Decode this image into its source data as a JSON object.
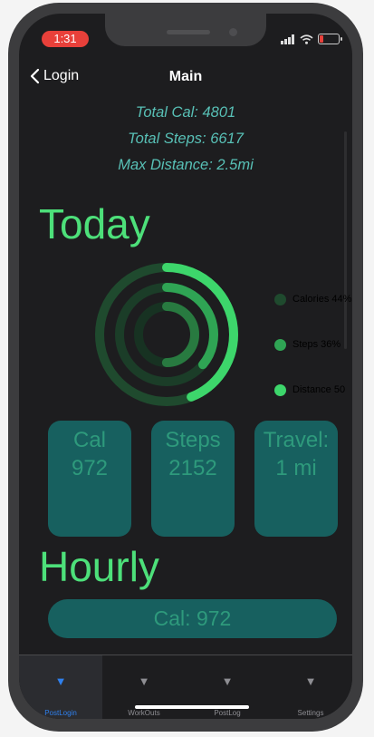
{
  "status_bar": {
    "time": "1:31"
  },
  "nav": {
    "back_label": "Login",
    "title": "Main"
  },
  "totals": {
    "total_cal": "Total Cal: 4801",
    "total_steps": "Total Steps: 6617",
    "max_distance": "Max Distance: 2.5mi"
  },
  "today": {
    "title": "Today",
    "rings": [
      {
        "name": "Calories",
        "percent": 44,
        "color": "#3dd66b",
        "track": "#1f4a2e"
      },
      {
        "name": "Steps",
        "percent": 36,
        "color": "#2fa454",
        "track": "#1b3d28"
      },
      {
        "name": "Distance",
        "percent": 50,
        "color": "#287a40",
        "track": "#173222"
      }
    ],
    "legend": [
      {
        "label": "Calories 44%",
        "color": "#1f4a2e"
      },
      {
        "label": "Steps 36%",
        "color": "#2fa454"
      },
      {
        "label": "Distance 50",
        "color": "#3dd66b"
      }
    ],
    "cards": [
      {
        "line1": "Cal",
        "line2": "972"
      },
      {
        "line1": "Steps",
        "line2": "2152"
      },
      {
        "line1": "Travel:",
        "line2": "1 mi"
      }
    ]
  },
  "hourly": {
    "title": "Hourly",
    "button_label": "Cal: 972"
  },
  "tabs": [
    {
      "label": "PostLogin",
      "active": true
    },
    {
      "label": "WorkOuts",
      "active": false
    },
    {
      "label": "PostLog",
      "active": false
    },
    {
      "label": "Settings",
      "active": false
    }
  ]
}
